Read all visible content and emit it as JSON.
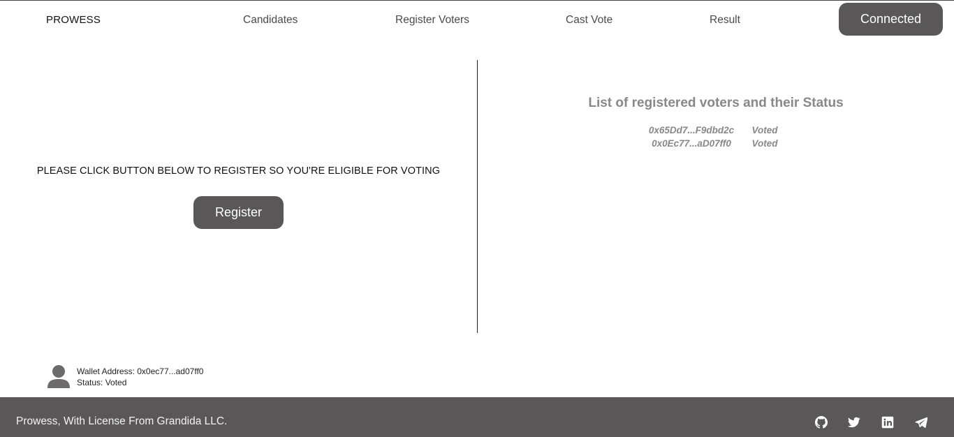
{
  "nav": {
    "brand": "PROWESS",
    "links": [
      "Candidates",
      "Register Voters",
      "Cast Vote",
      "Result"
    ],
    "connect_label": "Connected"
  },
  "register": {
    "instruction": "PLEASE CLICK BUTTON BELOW TO REGISTER SO YOU'RE ELIGIBLE FOR VOTING",
    "button_label": "Register"
  },
  "voters": {
    "title": "List of registered voters and their Status",
    "rows": [
      {
        "address": "0x65Dd7...F9dbd2c",
        "status": "Voted"
      },
      {
        "address": "0x0Ec77...aD07ff0",
        "status": "Voted"
      }
    ]
  },
  "wallet": {
    "address_line": "Wallet Address: 0x0ec77...ad07ff0",
    "status_line": "Status: Voted",
    "avatar_icon": "user-icon"
  },
  "footer": {
    "text": "Prowess, With License From Grandida LLC.",
    "social_icons": [
      "github-icon",
      "twitter-icon",
      "linkedin-icon",
      "telegram-icon"
    ]
  },
  "colors": {
    "accent": "#5a5758",
    "muted_text": "#8a8787",
    "footer_bg": "#5a5758"
  }
}
